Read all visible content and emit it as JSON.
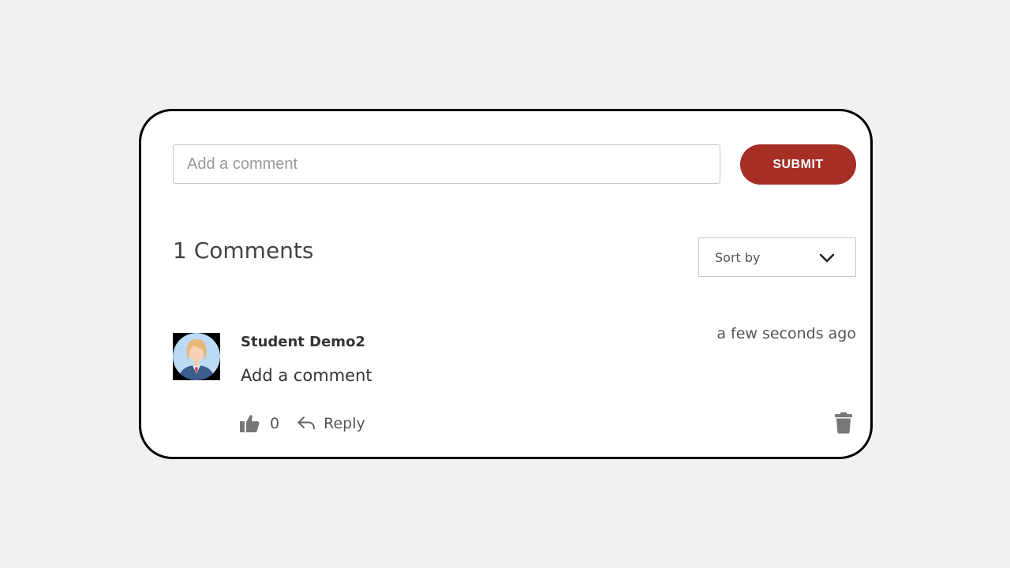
{
  "comment_form": {
    "placeholder": "Add a comment",
    "value": "",
    "submit_label": "SUBMIT"
  },
  "comments_header": {
    "count_label": "1 Comments",
    "sort_label": "Sort by"
  },
  "comments": [
    {
      "author": "Student Demo2",
      "timestamp": "a few seconds ago",
      "text": "Add a comment",
      "likes": "0",
      "reply_label": "Reply"
    }
  ],
  "icons": {
    "sort": "chevron-down-icon",
    "like": "thumbs-up-icon",
    "reply": "reply-arrow-icon",
    "delete": "trash-icon",
    "avatar": "user-avatar-icon"
  },
  "colors": {
    "accent": "#a52e25",
    "background": "#f1f1f1",
    "card": "#ffffff",
    "icon_gray": "#777777"
  }
}
